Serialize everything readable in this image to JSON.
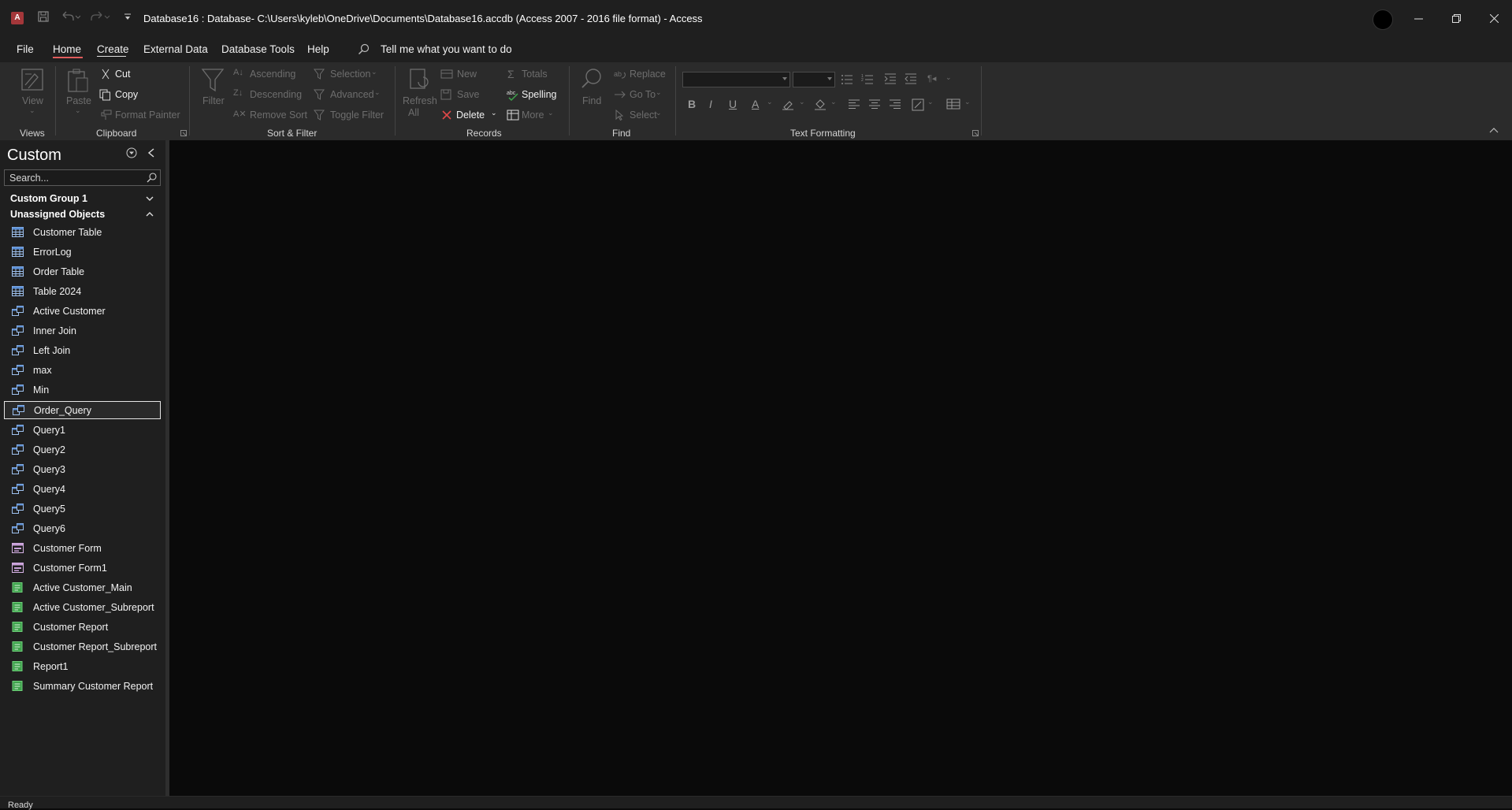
{
  "app": {
    "title": "Database16 : Database- C:\\Users\\kyleb\\OneDrive\\Documents\\Database16.accdb (Access 2007 - 2016 file format)  -  Access",
    "icon_letter": "A",
    "brand_color": "#a4373a"
  },
  "menu": {
    "tabs": [
      "File",
      "Home",
      "Create",
      "External Data",
      "Database Tools",
      "Help"
    ],
    "active_tab": "Home",
    "tell_me_placeholder": "Tell me what you want to do"
  },
  "ribbon": {
    "views": {
      "view_label": "View",
      "group_label": "Views"
    },
    "clipboard": {
      "paste_label": "Paste",
      "cut_label": "Cut",
      "copy_label": "Copy",
      "format_painter_label": "Format Painter",
      "group_label": "Clipboard"
    },
    "sort_filter": {
      "filter_label": "Filter",
      "ascending_label": "Ascending",
      "descending_label": "Descending",
      "remove_sort_label": "Remove Sort",
      "selection_label": "Selection",
      "advanced_label": "Advanced",
      "toggle_filter_label": "Toggle Filter",
      "group_label": "Sort & Filter"
    },
    "records": {
      "refresh_label": "Refresh",
      "refresh_all_label": "All",
      "new_label": "New",
      "save_label": "Save",
      "delete_label": "Delete",
      "totals_label": "Totals",
      "spelling_label": "Spelling",
      "more_label": "More",
      "group_label": "Records"
    },
    "find": {
      "find_label": "Find",
      "replace_label": "Replace",
      "goto_label": "Go To",
      "select_label": "Select",
      "group_label": "Find"
    },
    "text_formatting": {
      "bold": "B",
      "italic": "I",
      "underline": "U",
      "font_color_glyph": "A",
      "group_label": "Text Formatting"
    }
  },
  "nav": {
    "title": "Custom",
    "search_placeholder": "Search...",
    "groups": [
      {
        "label": "Custom Group 1",
        "state": "collapsed"
      },
      {
        "label": "Unassigned Objects",
        "state": "expanded"
      }
    ],
    "items": [
      {
        "label": "Customer Table",
        "type": "table"
      },
      {
        "label": "ErrorLog",
        "type": "table"
      },
      {
        "label": "Order Table",
        "type": "table"
      },
      {
        "label": "Table 2024",
        "type": "table"
      },
      {
        "label": "Active Customer",
        "type": "query"
      },
      {
        "label": "Inner Join",
        "type": "query"
      },
      {
        "label": "Left Join",
        "type": "query"
      },
      {
        "label": "max",
        "type": "query"
      },
      {
        "label": "Min",
        "type": "query"
      },
      {
        "label": "Order_Query",
        "type": "query",
        "selected": true
      },
      {
        "label": "Query1",
        "type": "query"
      },
      {
        "label": "Query2",
        "type": "query"
      },
      {
        "label": "Query3",
        "type": "query"
      },
      {
        "label": "Query4",
        "type": "query"
      },
      {
        "label": "Query5",
        "type": "query"
      },
      {
        "label": "Query6",
        "type": "query"
      },
      {
        "label": "Customer Form",
        "type": "form"
      },
      {
        "label": "Customer Form1",
        "type": "form"
      },
      {
        "label": "Active Customer_Main",
        "type": "report"
      },
      {
        "label": "Active Customer_Subreport",
        "type": "report"
      },
      {
        "label": "Customer Report",
        "type": "report"
      },
      {
        "label": "Customer Report_Subreport",
        "type": "report"
      },
      {
        "label": "Report1",
        "type": "report"
      },
      {
        "label": "Summary Customer Report",
        "type": "report"
      }
    ]
  },
  "status": {
    "text": "Ready"
  },
  "colors": {
    "accent_underline": "#e05c5c",
    "table_icon": "#5b8fd6",
    "query_icon": "#5b8fd6",
    "form_icon": "#c8a0d8",
    "report_icon": "#3fa34d"
  }
}
